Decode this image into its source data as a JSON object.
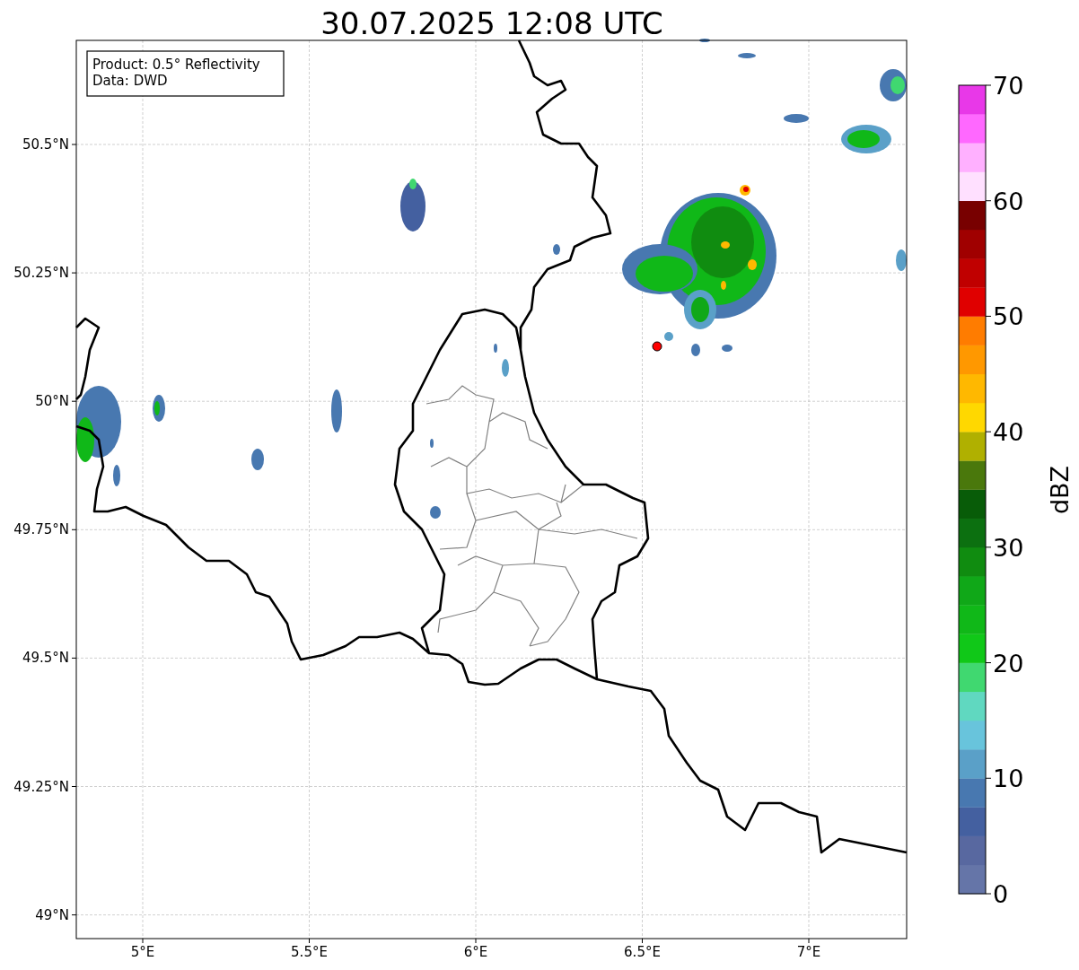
{
  "title": "30.07.2025 12:08 UTC",
  "info_box": {
    "lines": [
      "Product: 0.5° Reflectivity",
      "Data: DWD"
    ]
  },
  "lat_ticks": [
    "50.5°N",
    "50.25°N",
    "50°N",
    "49.75°N",
    "49.5°N",
    "49.25°N",
    "49°N"
  ],
  "lon_ticks": [
    "5°E",
    "5.5°E",
    "6°E",
    "6.5°E",
    "7°E"
  ],
  "colorbar": {
    "label": "dBZ",
    "ticks": [
      "70",
      "60",
      "50",
      "40",
      "30",
      "20",
      "10",
      "0"
    ],
    "bands": [
      {
        "color": "#6575a8"
      },
      {
        "color": "#5868a0"
      },
      {
        "color": "#4460a0"
      },
      {
        "color": "#4878b0"
      },
      {
        "color": "#5aa0c8"
      },
      {
        "color": "#68c4dc"
      },
      {
        "color": "#60d8c0"
      },
      {
        "color": "#40d870"
      },
      {
        "color": "#10c818"
      },
      {
        "color": "#10b818"
      },
      {
        "color": "#10a818"
      },
      {
        "color": "#108c10"
      },
      {
        "color": "#0c7010"
      },
      {
        "color": "#085c08"
      },
      {
        "color": "#4a780c"
      },
      {
        "color": "#b0b000"
      },
      {
        "color": "#ffd800"
      },
      {
        "color": "#ffb800"
      },
      {
        "color": "#ff9800"
      },
      {
        "color": "#ff7c00"
      },
      {
        "color": "#e00000"
      },
      {
        "color": "#c00000"
      },
      {
        "color": "#a00000"
      },
      {
        "color": "#780000"
      },
      {
        "color": "#ffe0ff"
      },
      {
        "color": "#ffb0ff"
      },
      {
        "color": "#ff68ff"
      },
      {
        "color": "#e838e8"
      }
    ]
  }
}
